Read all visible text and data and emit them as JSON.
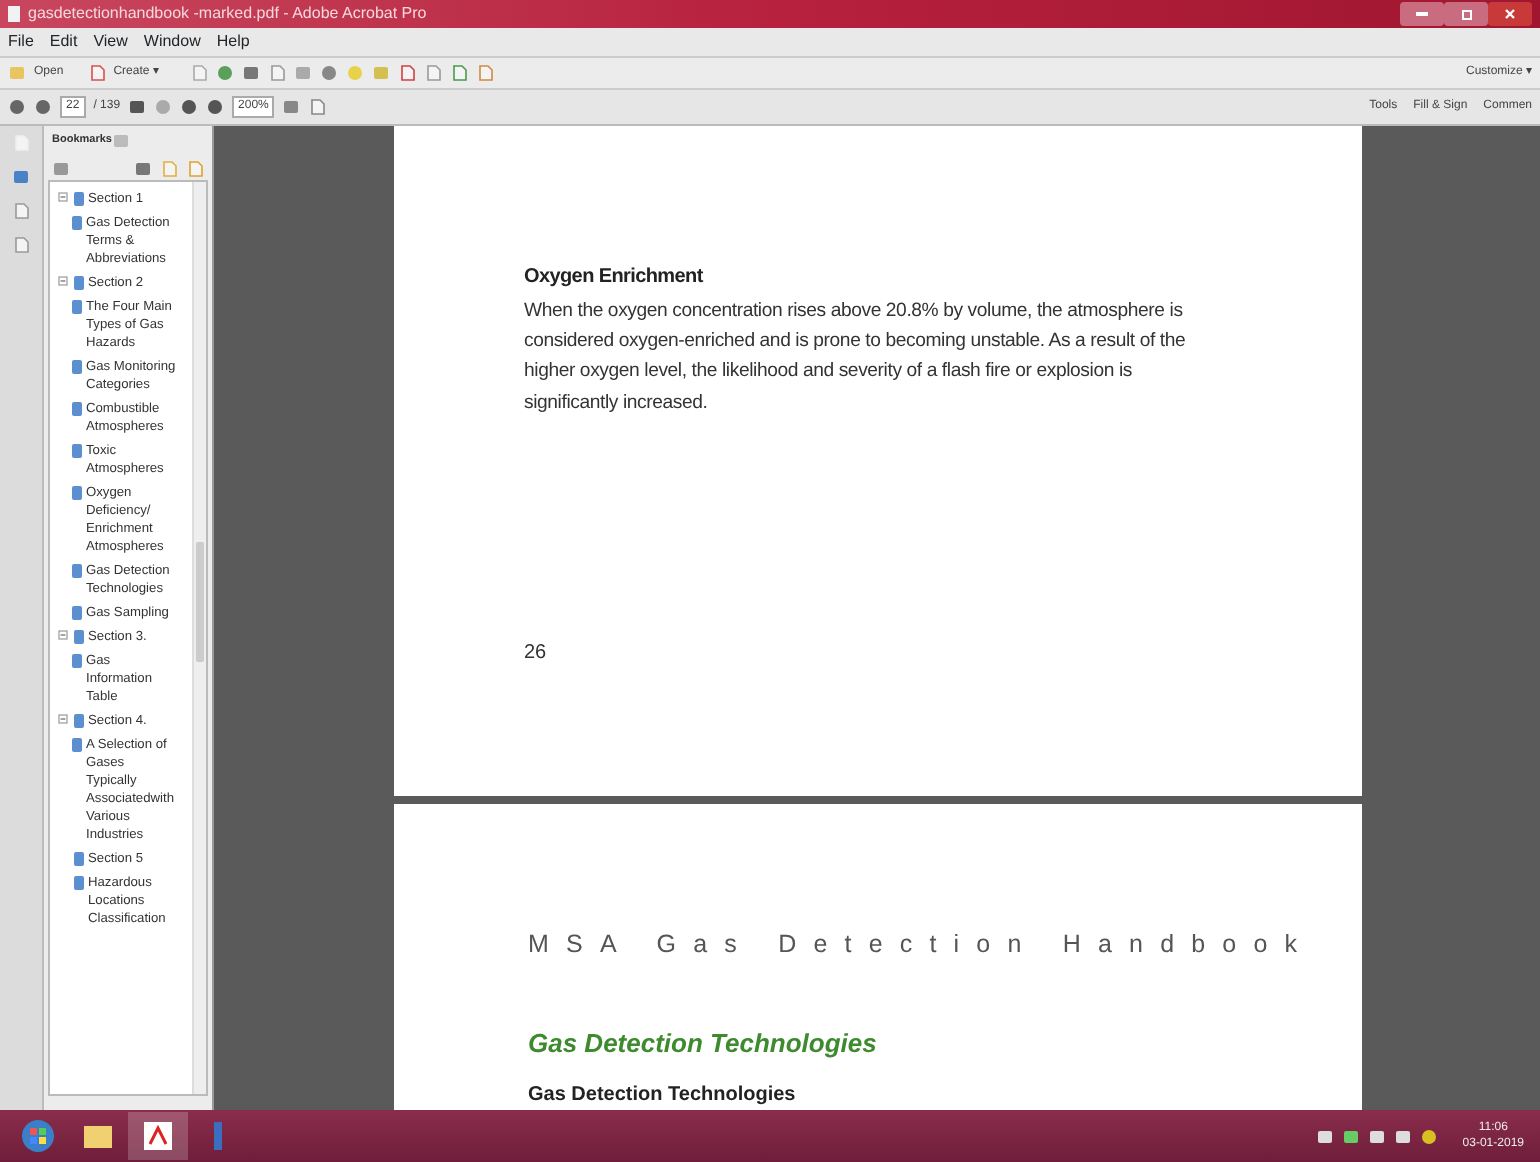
{
  "window": {
    "title": "gasdetectionhandbook -marked.pdf - Adobe Acrobat Pro"
  },
  "menu": [
    "File",
    "Edit",
    "View",
    "Window",
    "Help"
  ],
  "toolbar": {
    "open": "Open",
    "create": "Create",
    "create_caret": "▾",
    "customize": "Customize",
    "customize_caret": "▾"
  },
  "nav_toolbar": {
    "page": "22",
    "page_count": "/ 139",
    "zoom": "200%"
  },
  "task_tabs": [
    "Tools",
    "Fill & Sign",
    "Commen"
  ],
  "bookmarks": {
    "title": "Bookmarks",
    "items": [
      {
        "label": "Section 1",
        "expanded": true,
        "children": [
          {
            "label": "Gas Detection Terms & Abbreviations"
          }
        ]
      },
      {
        "label": "Section 2",
        "expanded": true,
        "children": [
          {
            "label": "The Four Main Types of Gas Hazards"
          },
          {
            "label": "Gas Monitoring Categories"
          },
          {
            "label": "Combustible Atmospheres"
          },
          {
            "label": "Toxic Atmospheres"
          },
          {
            "label": "Oxygen Deficiency/ Enrichment Atmospheres"
          },
          {
            "label": "Gas Detection Technologies"
          },
          {
            "label": "Gas Sampling"
          }
        ]
      },
      {
        "label": "Section 3.",
        "expanded": true,
        "children": [
          {
            "label": "Gas Information Table"
          }
        ]
      },
      {
        "label": "Section 4.",
        "expanded": true,
        "children": [
          {
            "label": "A Selection of Gases Typically Associatedwith Various Industries"
          }
        ]
      },
      {
        "label": "Section 5"
      },
      {
        "label": "Hazardous Locations Classification"
      }
    ]
  },
  "document": {
    "page1": {
      "heading": "Oxygen Enrichment",
      "body": "When the oxygen concentration rises above 20.8% by volume, the atmosphere is considered oxygen-enriched and is prone to becoming unstable. As a result of the higher oxygen level, the likelihood and severity of a flash fire or explosion is significantly increased.",
      "page_number": "26"
    },
    "page2": {
      "running_title": "MSA Gas Detection Handbook",
      "section_title": "Gas Detection Technologies",
      "subheading": "Gas Detection Technologies"
    }
  },
  "taskbar": {
    "time": "11:06",
    "date": "03-01-2019"
  }
}
